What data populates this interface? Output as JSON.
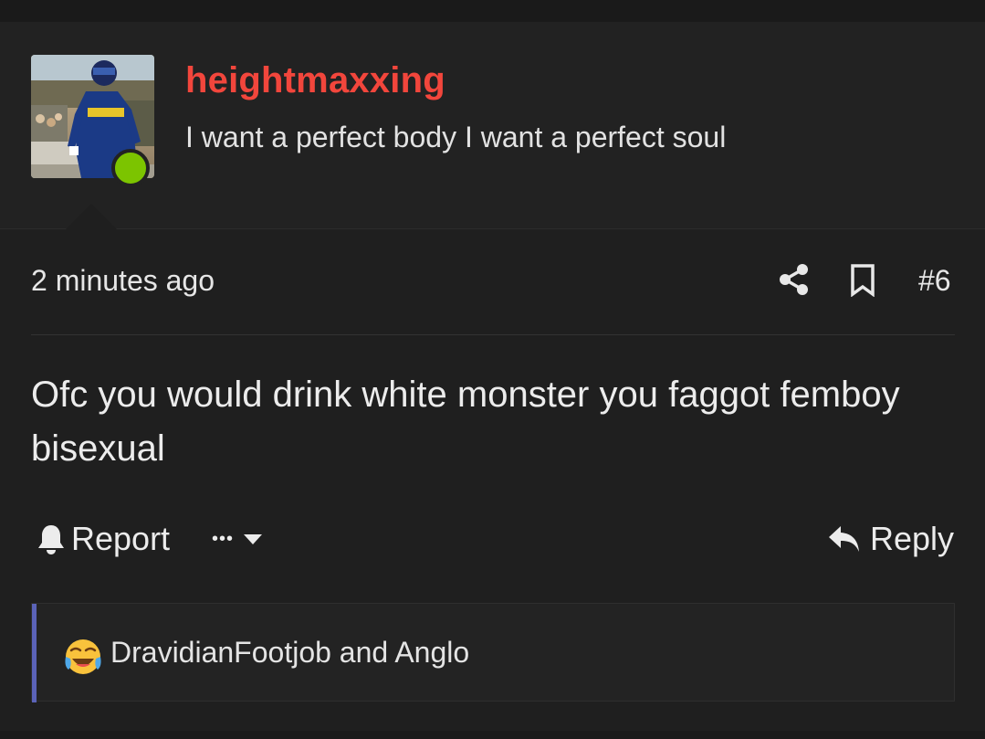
{
  "post": {
    "username": "heightmaxxing",
    "user_title": "I want a perfect body I want a perfect soul",
    "timestamp": "2 minutes ago",
    "post_number": "#6",
    "message": "Ofc you would drink white monster you faggot femboy bisexual",
    "online_status_color": "#7cc400"
  },
  "actions": {
    "report_label": "Report",
    "more_label": "•••",
    "reply_label": "Reply"
  },
  "reactions": {
    "emoji": "crying-laughing-face",
    "text": "DravidianFootjob and Anglo"
  },
  "colors": {
    "username": "#f2463c",
    "reaction_bar": "#5b63b8",
    "background": "#1f1f1f"
  }
}
